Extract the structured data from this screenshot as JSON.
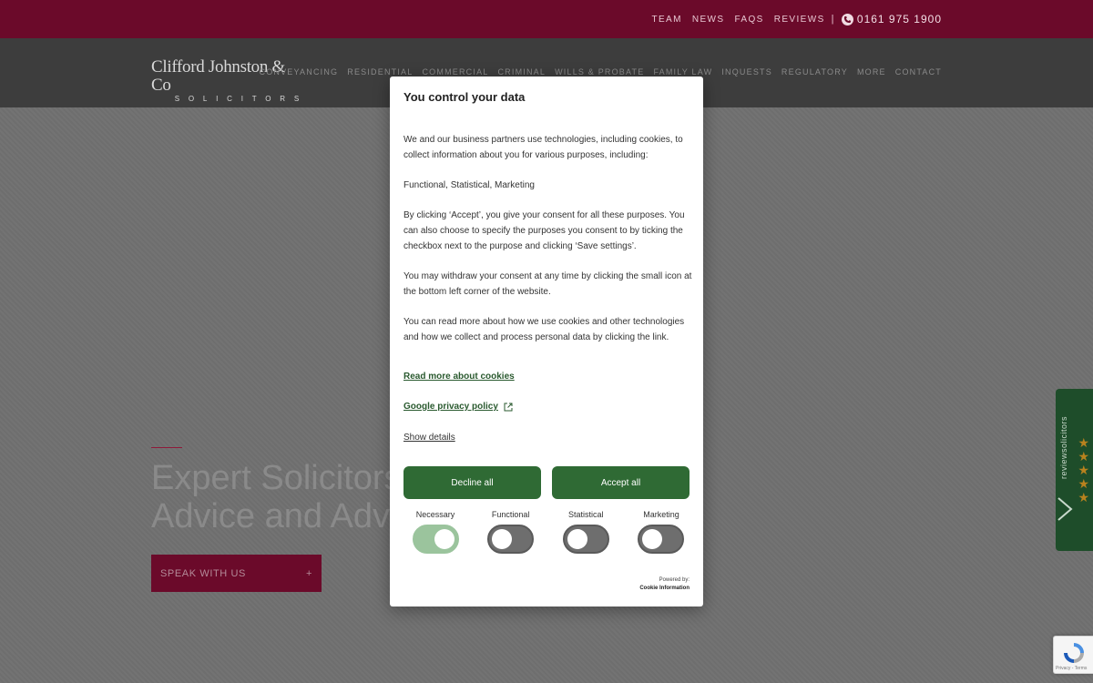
{
  "top_nav": {
    "items": [
      "TEAM",
      "NEWS",
      "FAQS",
      "REVIEWS"
    ],
    "separator": "|",
    "phone": "0161 975 1900"
  },
  "logo": {
    "line1": "Clifford Johnston & Co",
    "line2": "SOLICITORS"
  },
  "main_nav": {
    "items": [
      "CONVEYANCING",
      "RESIDENTIAL",
      "COMMERCIAL",
      "CRIMINAL",
      "WILLS & PROBATE",
      "FAMILY LAW",
      "INQUESTS",
      "REGULATORY",
      "MORE",
      "CONTACT"
    ]
  },
  "hero": {
    "title_line1": "Expert Solicitors",
    "title_line2": "Advice and Adv",
    "cta_label": "SPEAK WITH US",
    "cta_icon": "+"
  },
  "review_widget": {
    "label": "reviewsolicitors",
    "stars": 5
  },
  "recaptcha": {
    "text": "Privacy - Terms"
  },
  "cookie_modal": {
    "title": "You control your data",
    "paragraphs": [
      "We and our business partners use technologies, including cookies, to collect information about you for various purposes, including:",
      "Functional, Statistical, Marketing",
      "By clicking ‘Accept’, you give your consent for all these purposes. You can also choose to specify the purposes you consent to by ticking the checkbox next to the purpose and clicking ‘Save settings’.",
      "You may withdraw your consent at any time by clicking the small icon at the bottom left corner of the website.",
      "You can read more about how we use cookies and other technologies and how we collect and process personal data by clicking the link."
    ],
    "read_more_link": "Read more about cookies",
    "privacy_link": "Google privacy policy",
    "show_details": "Show details",
    "decline_label": "Decline all",
    "accept_label": "Accept all",
    "toggles": [
      {
        "label": "Necessary",
        "on": true
      },
      {
        "label": "Functional",
        "on": false
      },
      {
        "label": "Statistical",
        "on": false
      },
      {
        "label": "Marketing",
        "on": false
      }
    ],
    "powered_by": "Powered by:",
    "powered_brand": "Cookie Information"
  },
  "colors": {
    "brand_maroon": "#6b0a2a",
    "accept_green": "#2f6a34",
    "toggle_on": "#9bc49d",
    "review_green": "#1e4d2a"
  }
}
